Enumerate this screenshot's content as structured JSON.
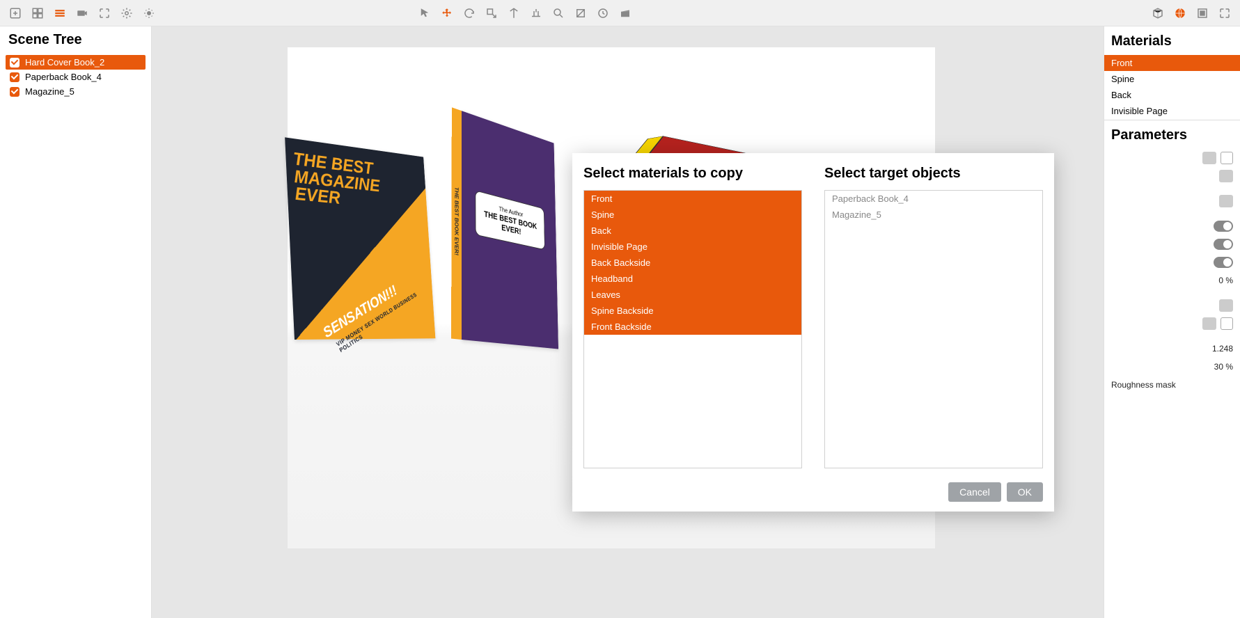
{
  "accent": "#e8590c",
  "toolbar": {
    "left": [
      "add-icon",
      "grid-icon",
      "layers-icon",
      "camera-icon",
      "focus-icon",
      "gear-icon",
      "sun-icon"
    ],
    "center": [
      "cursor-icon",
      "move-icon",
      "rotate-icon",
      "scale-icon",
      "pivot-icon",
      "snap-icon",
      "magnify-icon",
      "crop-icon",
      "time-icon",
      "clapper-icon"
    ],
    "right": [
      "cube-icon",
      "globe-icon",
      "window-icon",
      "expand-icon"
    ]
  },
  "scene_tree": {
    "title": "Scene Tree",
    "items": [
      {
        "label": "Hard Cover Book_2",
        "checked": true,
        "selected": true
      },
      {
        "label": "Paperback Book_4",
        "checked": true,
        "selected": false
      },
      {
        "label": "Magazine_5",
        "checked": true,
        "selected": false
      }
    ]
  },
  "viewport": {
    "magazine": {
      "title_line1": "THE BEST",
      "title_line2": "MAGAZINE",
      "title_line3": "EVER",
      "headline": "SENSATION!!!",
      "tags": "VIP MONEY SEX WORLD BUSINESS POLITICS"
    },
    "paperback": {
      "author": "The Author",
      "title": "THE BEST BOOK EVER!",
      "spine": "THE BEST BOOK EVER!"
    }
  },
  "materials_panel": {
    "title": "Materials",
    "items": [
      {
        "label": "Front",
        "selected": true
      },
      {
        "label": "Spine",
        "selected": false
      },
      {
        "label": "Back",
        "selected": false
      },
      {
        "label": "Invisible Page",
        "selected": false
      }
    ]
  },
  "parameters_panel": {
    "title": "Parameters",
    "rows": [
      {
        "kind": "boxrow"
      },
      {
        "kind": "btnrow"
      },
      {
        "kind": "spacer"
      },
      {
        "kind": "btnrow"
      },
      {
        "kind": "spacer"
      },
      {
        "kind": "toggle"
      },
      {
        "kind": "toggle"
      },
      {
        "kind": "toggle"
      },
      {
        "kind": "value",
        "value": "0 %"
      },
      {
        "kind": "spacer"
      },
      {
        "kind": "folder"
      },
      {
        "kind": "boxrow"
      },
      {
        "kind": "spacer"
      },
      {
        "kind": "value",
        "value": "1.248"
      },
      {
        "kind": "value",
        "value": "30 %"
      },
      {
        "kind": "label",
        "value": "Roughness mask"
      }
    ]
  },
  "copy_modal": {
    "left_title": "Select materials to copy",
    "right_title": "Select target objects",
    "materials": [
      {
        "label": "Front",
        "selected": true
      },
      {
        "label": "Spine",
        "selected": true
      },
      {
        "label": "Back",
        "selected": true
      },
      {
        "label": "Invisible Page",
        "selected": true
      },
      {
        "label": "Back Backside",
        "selected": true
      },
      {
        "label": "Headband",
        "selected": true
      },
      {
        "label": "Leaves",
        "selected": true
      },
      {
        "label": "Spine Backside",
        "selected": true
      },
      {
        "label": "Front Backside",
        "selected": true
      }
    ],
    "targets": [
      {
        "label": "Paperback Book_4",
        "selected": false
      },
      {
        "label": "Magazine_5",
        "selected": false
      }
    ],
    "cancel_label": "Cancel",
    "ok_label": "OK"
  }
}
